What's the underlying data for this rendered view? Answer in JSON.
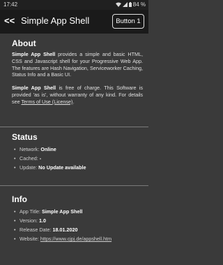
{
  "statusbar": {
    "time": "17:42",
    "battery": "84 %",
    "icons": [
      "wifi-icon",
      "signal-icon",
      "battery-icon"
    ]
  },
  "header": {
    "back_label": "<<",
    "title": "Simple App Shell",
    "button_label": "Button 1"
  },
  "about": {
    "heading": "About",
    "para1": {
      "bold": "Simple App Shell",
      "text": " provides a simple and basic HTML, CSS and Javascript shell for your Progressive Web App. The features are Hash Navigation, Serviceworker Caching, Status Info and a Basic UI."
    },
    "para2": {
      "bold": "Simple App Shell",
      "text": " is free of charge. This Software is provided 'as is', without warranty of any kind. For details see ",
      "link": "Terms of Use (License)",
      "end": "."
    }
  },
  "status": {
    "heading": "Status",
    "items": [
      {
        "label": "Network: ",
        "value": "Online"
      },
      {
        "label": "Cached: ",
        "value": "-"
      },
      {
        "label": "Update: ",
        "value": "No Update available"
      }
    ]
  },
  "info": {
    "heading": "Info",
    "items": [
      {
        "label": "App Title: ",
        "value": "Simple App Shell"
      },
      {
        "label": "Version: ",
        "value": "1.0"
      },
      {
        "label": "Release Date: ",
        "value": "18.01.2020"
      },
      {
        "label": "Website: ",
        "value": "https://www.cjpj.de/appshell.htm"
      }
    ]
  }
}
